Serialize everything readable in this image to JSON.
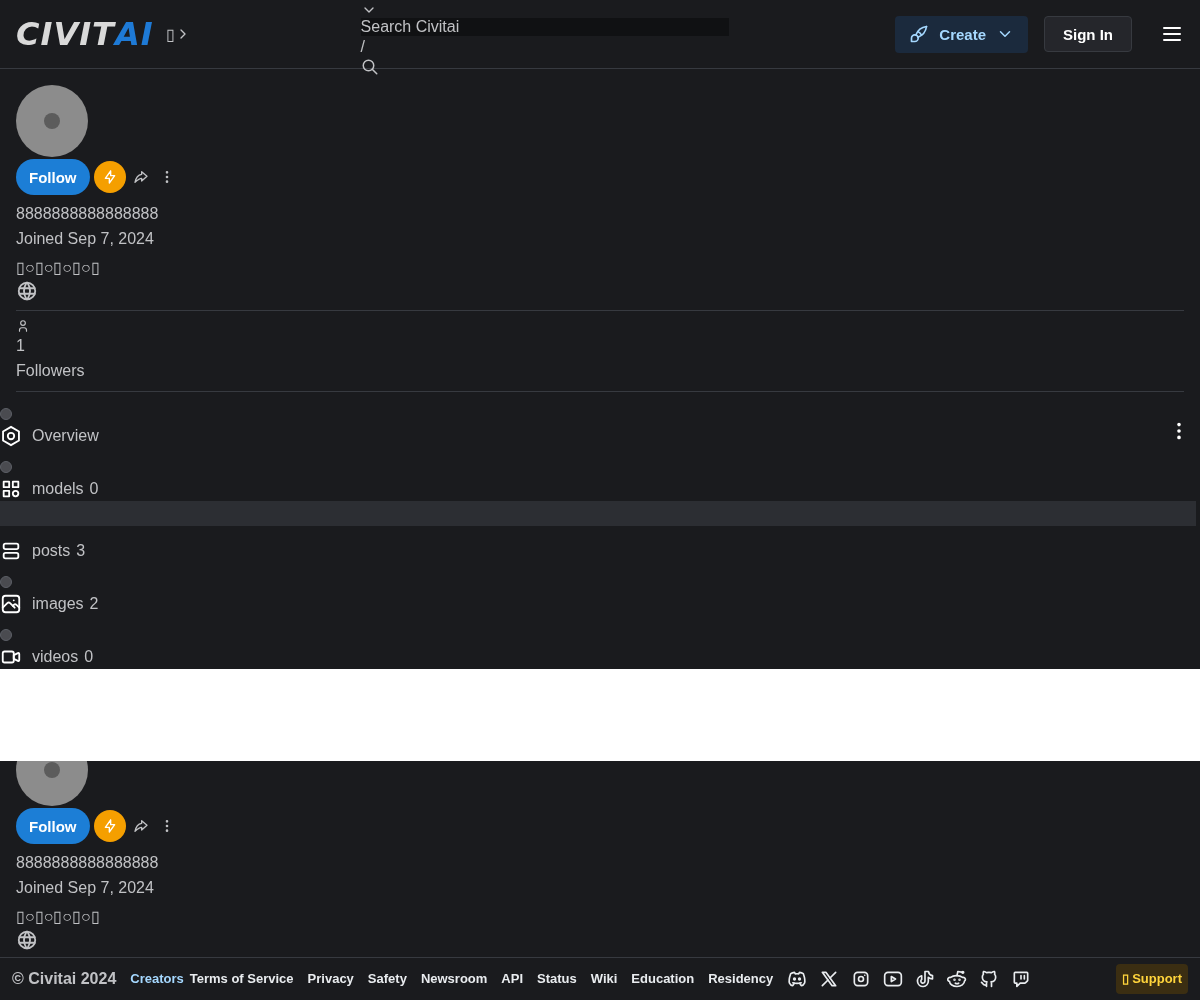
{
  "header": {
    "logo": {
      "part1": "CIVIT",
      "part2": "AI"
    },
    "missing_glyph": "▯",
    "search": {
      "placeholder": "Search Civitai",
      "shortcut": "/"
    },
    "create_button": "Create",
    "sign_in_button": "Sign In"
  },
  "profile": {
    "follow_button": "Follow",
    "username": "8888888888888888",
    "joined": "Joined Sep 7, 2024",
    "badges": "▯○▯○▯○▯○▯"
  },
  "stats": {
    "followers_count": "1",
    "followers_label": "Followers"
  },
  "tabs": [
    {
      "kind": "overview",
      "label": "Overview",
      "selected": false
    },
    {
      "kind": "models",
      "label": "models",
      "count": "0",
      "selected": false
    },
    {
      "kind": "posts",
      "label": "posts",
      "count": "3",
      "selected": true
    },
    {
      "kind": "images",
      "label": "images",
      "count": "2",
      "selected": false
    },
    {
      "kind": "videos",
      "label": "videos",
      "count": "0",
      "selected": false
    }
  ],
  "sticky_profile": {
    "follow_button": "Follow",
    "username": "8888888888888888",
    "joined": "Joined Sep 7, 2024",
    "badges": "▯○▯○▯○▯○▯"
  },
  "footer": {
    "copyright": "© Civitai 2024",
    "links": [
      {
        "label": "Creators",
        "highlighted": true
      },
      {
        "label": "Terms of Service",
        "highlighted": false
      },
      {
        "label": "Privacy",
        "highlighted": false
      },
      {
        "label": "Safety",
        "highlighted": false
      },
      {
        "label": "Newsroom",
        "highlighted": false
      },
      {
        "label": "API",
        "highlighted": false
      },
      {
        "label": "Status",
        "highlighted": false
      },
      {
        "label": "Wiki",
        "highlighted": false
      },
      {
        "label": "Education",
        "highlighted": false
      },
      {
        "label": "Residency",
        "highlighted": false
      }
    ],
    "support_button": "▯ Support"
  }
}
